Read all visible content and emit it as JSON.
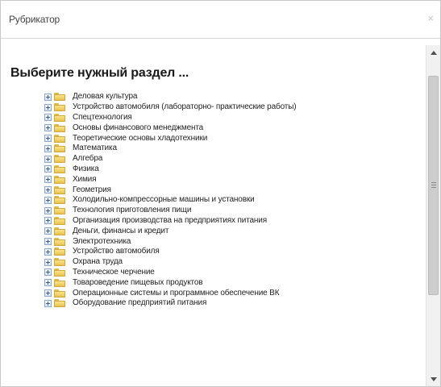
{
  "dialog": {
    "title": "Рубрикатор",
    "close_glyph": "×"
  },
  "content": {
    "heading": "Выберите нужный раздел ...",
    "items": [
      {
        "label": "Деловая культура"
      },
      {
        "label": "Устройство автомобиля (лабораторно- практические работы)"
      },
      {
        "label": "Спецтехнология"
      },
      {
        "label": "Основы финансового менеджмента"
      },
      {
        "label": "Теоретические основы хладотехники"
      },
      {
        "label": "Математика"
      },
      {
        "label": "Алгебра"
      },
      {
        "label": "Физика"
      },
      {
        "label": "Химия"
      },
      {
        "label": "Геометрия"
      },
      {
        "label": "Холодильно-компрессорные машины и установки"
      },
      {
        "label": "Технология приготовления пищи"
      },
      {
        "label": "Организация производства на предприятиях питания"
      },
      {
        "label": "Деньги, финансы и кредит"
      },
      {
        "label": "Электротехника"
      },
      {
        "label": "Устройство автомобиля"
      },
      {
        "label": "Охрана труда"
      },
      {
        "label": "Техническое черчение"
      },
      {
        "label": "Товароведение пищевых продуктов"
      },
      {
        "label": "Операционные системы и программное обеспечение ВК"
      },
      {
        "label": "Оборудование предприятий питания"
      }
    ]
  },
  "icons": {
    "expander": "plus-box-icon",
    "folder": "folder-icon",
    "close": "close-icon",
    "scroll_up": "arrow-up-icon",
    "scroll_down": "arrow-down-icon"
  },
  "colors": {
    "folder": "#f0cc5f",
    "expander_border": "#8aa7cf",
    "text": "#1f1f1f",
    "scrollbar_thumb": "#cdcdcd"
  }
}
